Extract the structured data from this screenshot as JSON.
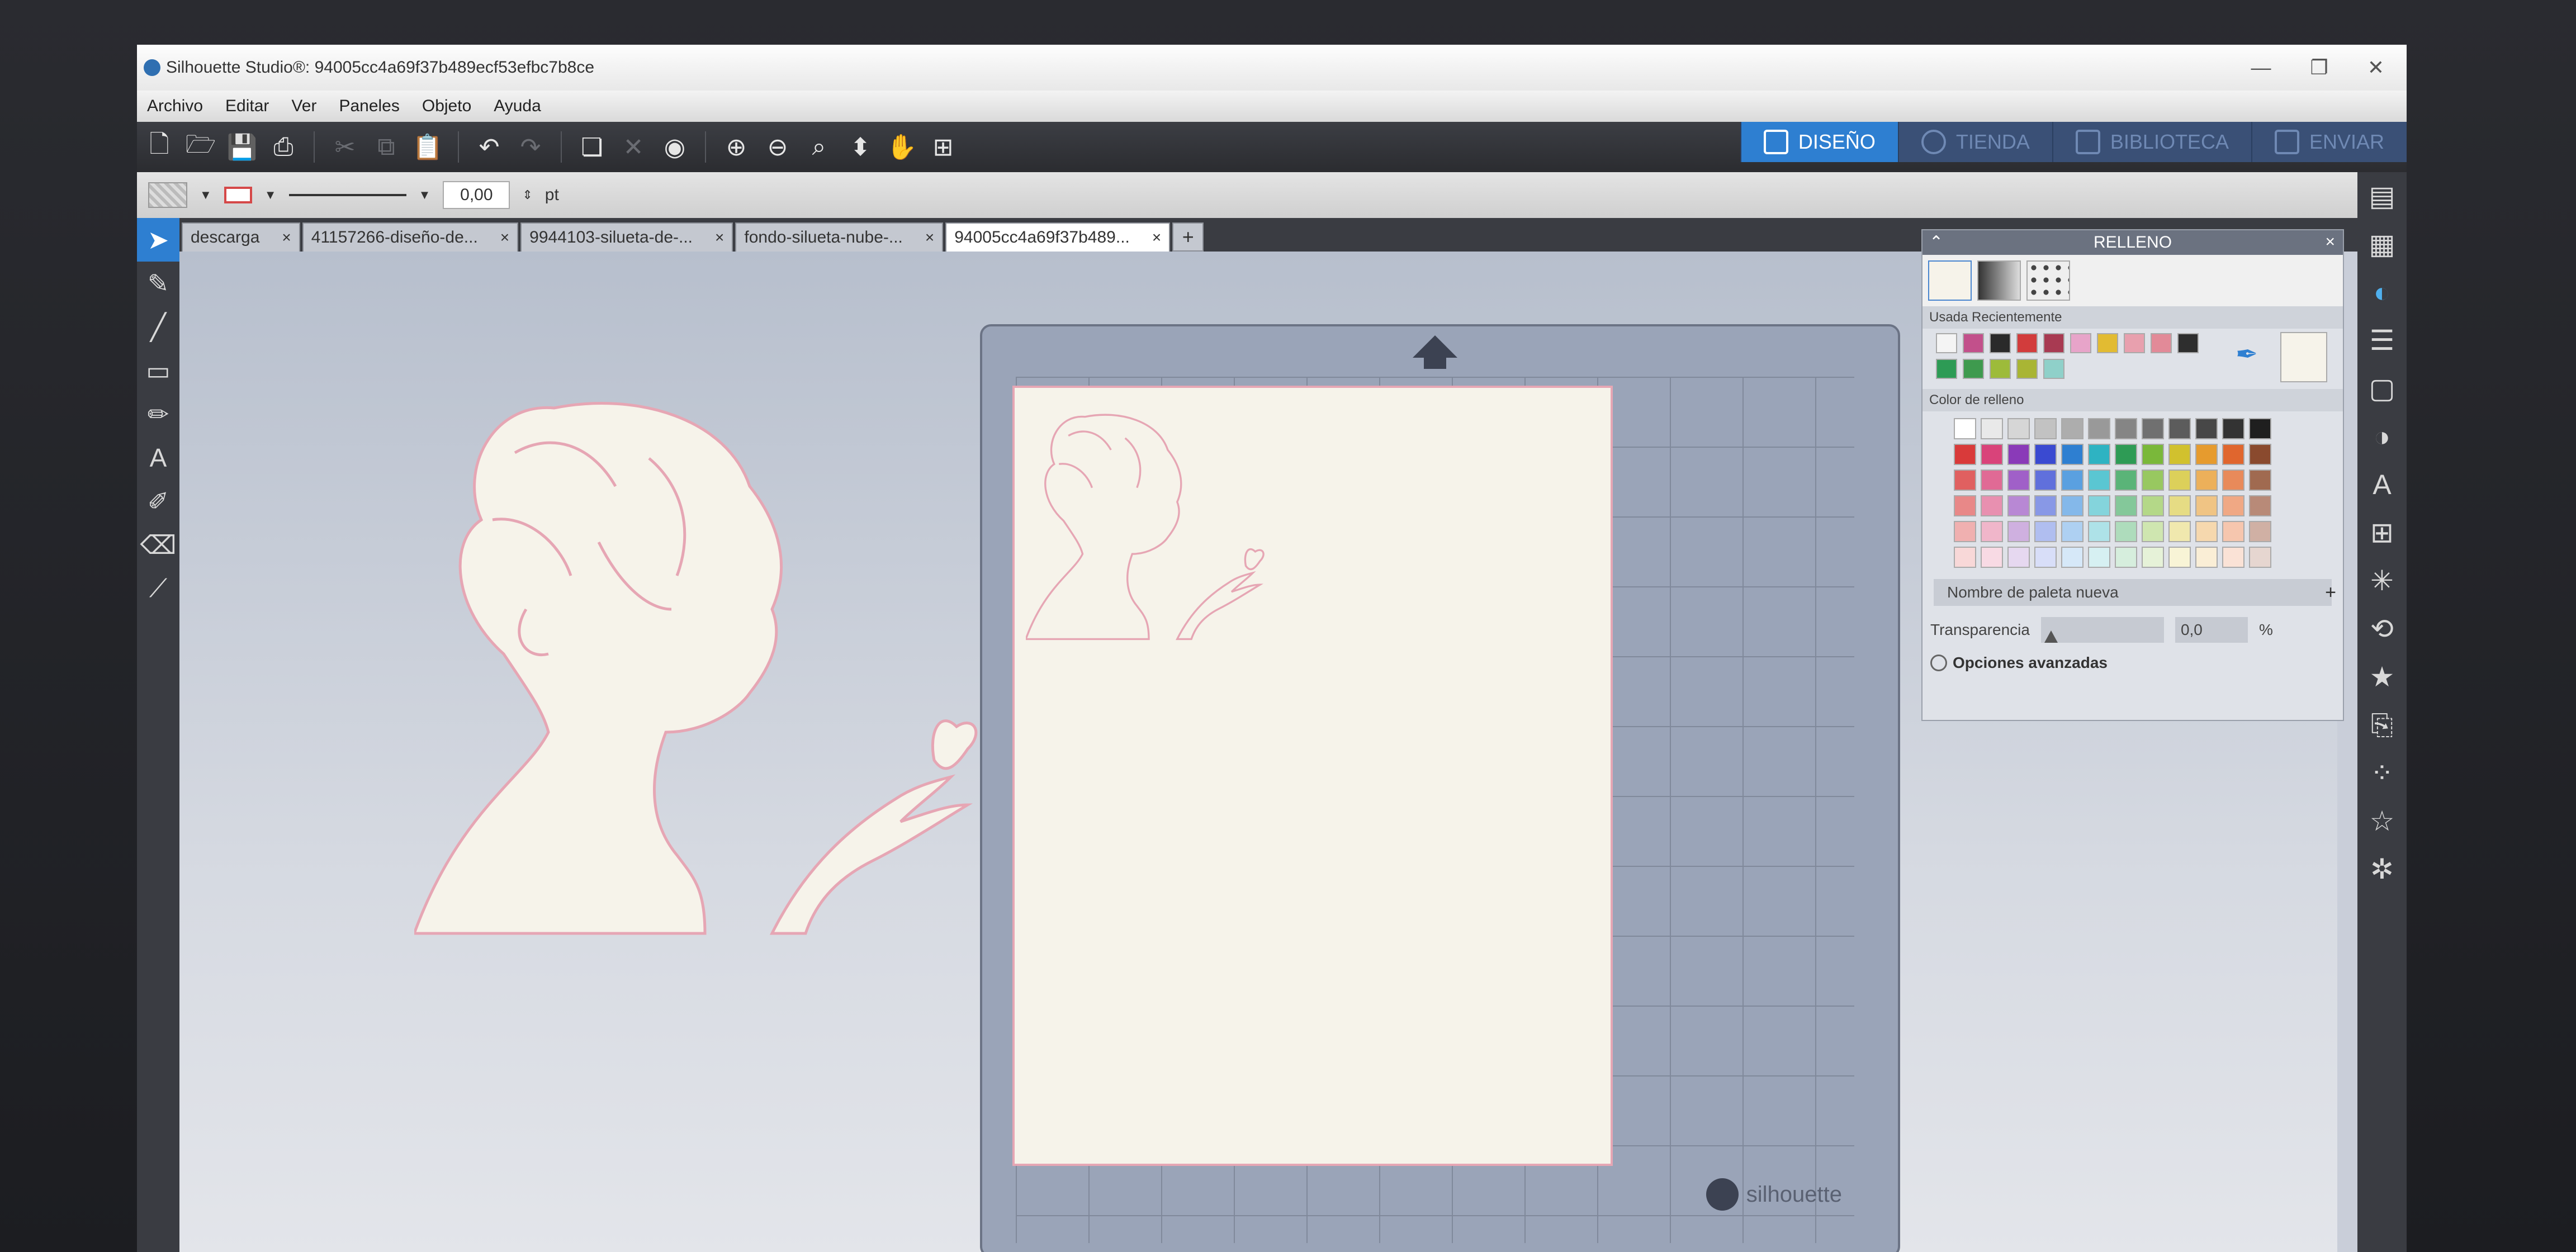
{
  "window": {
    "title": "Silhouette Studio®: 94005cc4a69f37b489ecf53efbc7b8ce",
    "controls": [
      "—",
      "❐",
      "✕"
    ]
  },
  "menu": [
    "Archivo",
    "Editar",
    "Ver",
    "Paneles",
    "Objeto",
    "Ayuda"
  ],
  "mode_tabs": [
    {
      "label": "DISEÑO",
      "active": true
    },
    {
      "label": "TIENDA",
      "active": false
    },
    {
      "label": "BIBLIOTECA",
      "active": false
    },
    {
      "label": "ENVIAR",
      "active": false
    }
  ],
  "stylebar": {
    "line_width": "0,00",
    "unit": "pt"
  },
  "doc_tabs": [
    {
      "label": "descarga",
      "active": false
    },
    {
      "label": "41157266-diseño-de...",
      "active": false
    },
    {
      "label": "9944103-silueta-de-...",
      "active": false
    },
    {
      "label": "fondo-silueta-nube-...",
      "active": false
    },
    {
      "label": "94005cc4a69f37b489...",
      "active": true
    }
  ],
  "mat": {
    "brand": "silhouette"
  },
  "fill_panel": {
    "title": "RELLENO",
    "recent_label": "Usada Recientemente",
    "recent_colors": [
      "#f4f4f4",
      "#c2508b",
      "#2a2a2a",
      "#d23c3c",
      "#a83a52",
      "#e7a4c9",
      "#e2bb32",
      "#e8a0ae",
      "#e28a98",
      "#2e2e2e",
      "#2d9b55",
      "#3e9a4e",
      "#9dbb3a",
      "#a9b534",
      "#8fd0c9"
    ],
    "fill_color_label": "Color de relleno",
    "palette_rows": [
      [
        "#ffffff",
        "#e9e9e9",
        "#d6d6d6",
        "#c2c2c2",
        "#adadad",
        "#999999",
        "#858585",
        "#707070",
        "#5c5c5c",
        "#474747",
        "#333333",
        "#1f1f1f"
      ],
      [
        "#d93a3a",
        "#d9437a",
        "#8a3ab8",
        "#3a4ad1",
        "#2e7fd1",
        "#2eb3c2",
        "#2e9b55",
        "#7ab83a",
        "#d1c12e",
        "#e69b2e",
        "#e0662e",
        "#8a4a2e"
      ],
      [
        "#e06060",
        "#e06a95",
        "#a060c8",
        "#6070dc",
        "#5aa0e0",
        "#5ac6d2",
        "#5ab478",
        "#98c860",
        "#dcd05a",
        "#ecb05a",
        "#e88a5a",
        "#a06a50"
      ],
      [
        "#e88888",
        "#e890b0",
        "#b888d4",
        "#8898e6",
        "#84b8ea",
        "#84d4dc",
        "#84c89a",
        "#b4d888",
        "#e6dc84",
        "#f0c484",
        "#f0a884",
        "#b88a78"
      ],
      [
        "#f0b0b0",
        "#f0b6ca",
        "#cfb0e0",
        "#b0bef0",
        "#aed0f2",
        "#aee2e8",
        "#aedcbc",
        "#cfe6b0",
        "#f0e8ae",
        "#f6d8ae",
        "#f6c6ae",
        "#d0b0a4"
      ],
      [
        "#f8d8d8",
        "#f8dae4",
        "#e6d8f0",
        "#d8def8",
        "#d6e8f8",
        "#d6f0f2",
        "#d6eedd",
        "#e6f2d8",
        "#f8f4d6",
        "#faeed6",
        "#fae2d6",
        "#e6d6d0"
      ]
    ],
    "palette_name_placeholder": "Nombre de paleta nueva",
    "transparency_label": "Transparencia",
    "transparency_value": "0,0",
    "transparency_unit": "%",
    "advanced_label": "Opciones avanzadas"
  },
  "colors": {
    "accent": "#2e7fd1",
    "silhouette_fill": "#f6f3ea",
    "silhouette_stroke": "#e6a6b4",
    "mat": "#9aa4b8"
  }
}
